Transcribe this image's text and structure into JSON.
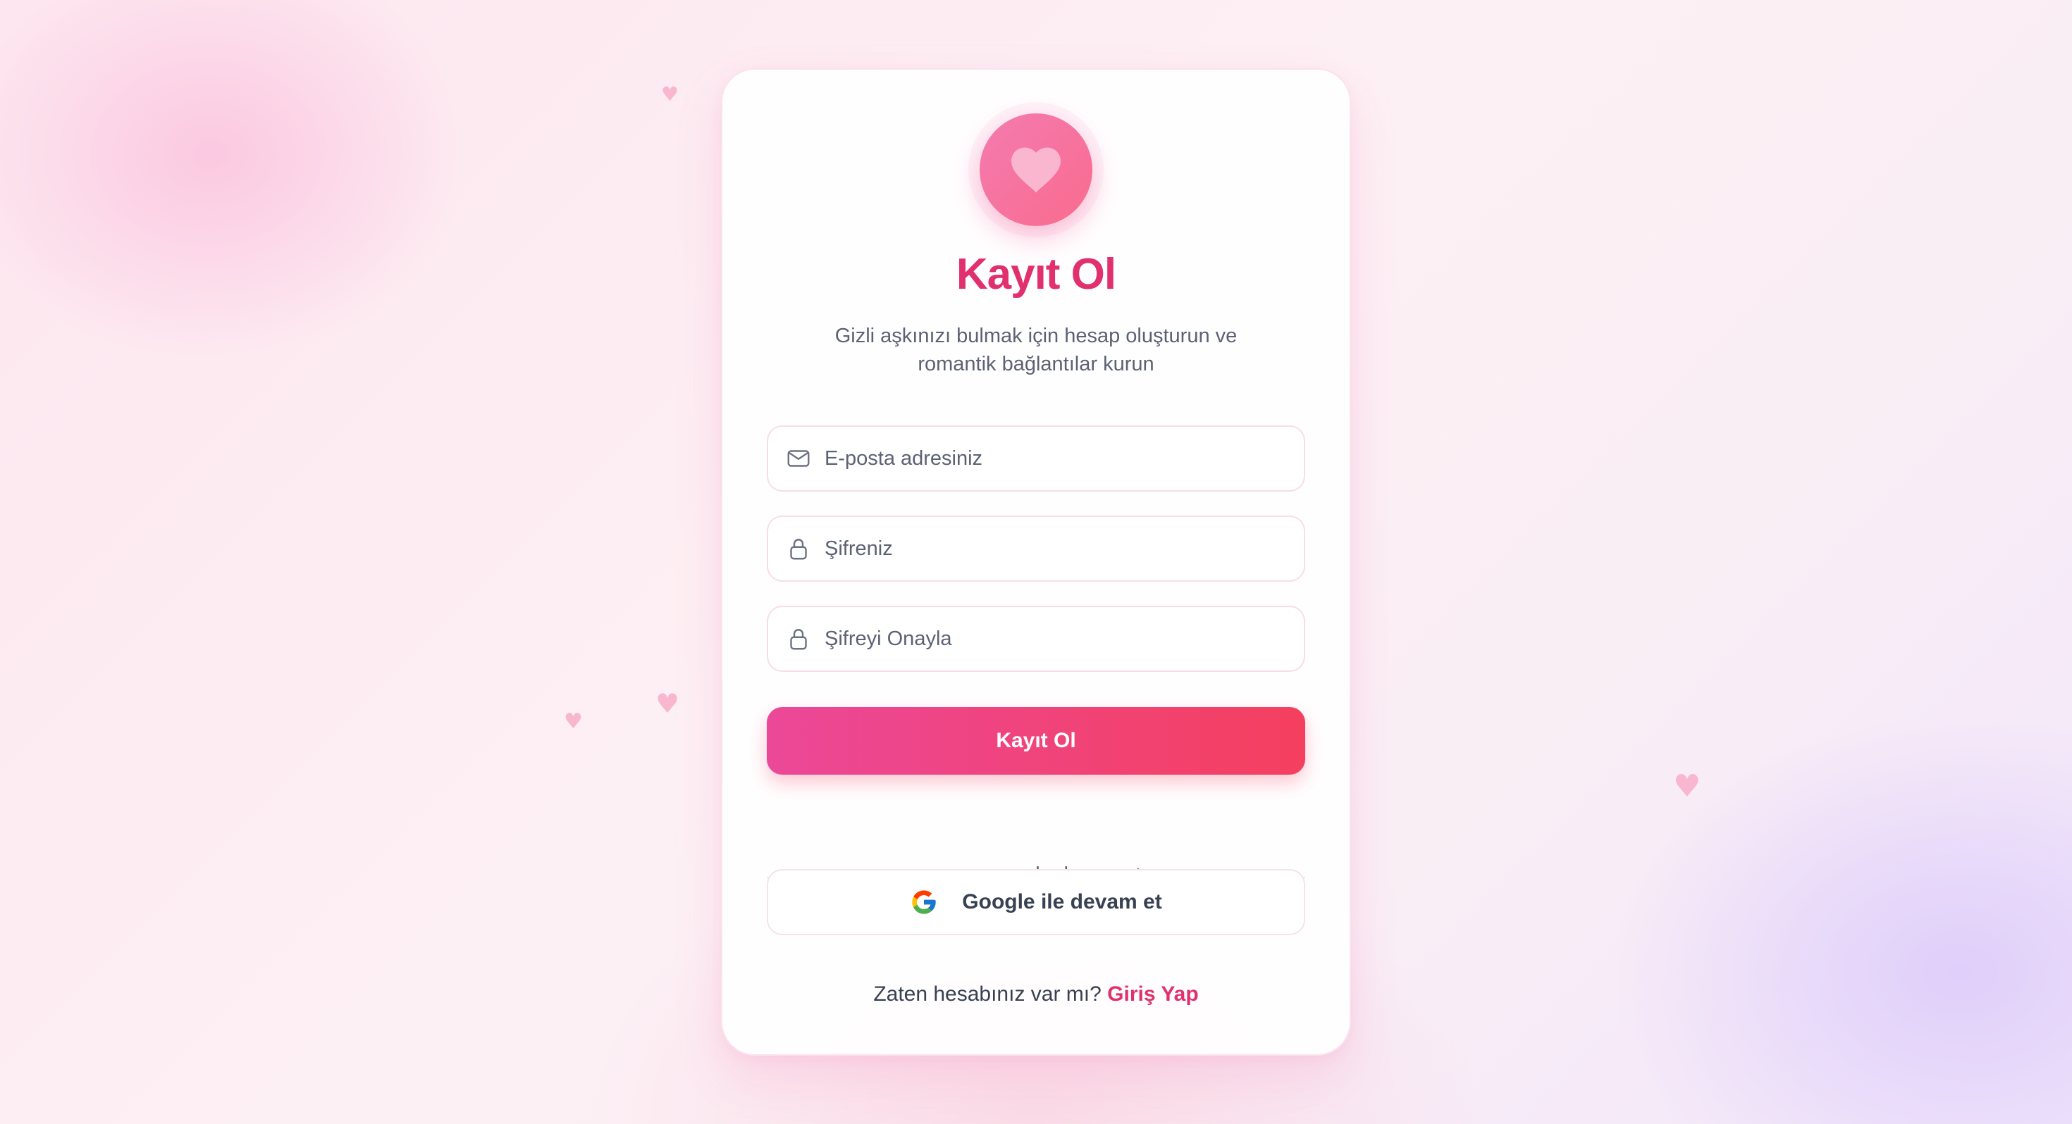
{
  "colors": {
    "accent": "#e0306e",
    "button_gradient_start": "#ec4899",
    "button_gradient_end": "#f43f5e",
    "logo_gradient_start": "#f47bb0",
    "logo_gradient_end": "#f96b8e",
    "muted_text": "#5b6273"
  },
  "card": {
    "logo_icon": "heart-icon",
    "title": "Kayıt Ol",
    "subtitle": "Gizli aşkınızı bulmak için hesap oluşturun ve romantik bağlantılar kurun"
  },
  "form": {
    "email": {
      "icon": "mail-icon",
      "placeholder": "E-posta adresiniz",
      "value": ""
    },
    "password": {
      "icon": "lock-icon",
      "placeholder": "Şifreniz",
      "value": ""
    },
    "confirm_password": {
      "icon": "lock-icon",
      "placeholder": "Şifreyi Onayla",
      "value": ""
    },
    "submit_label": "Kayıt Ol"
  },
  "divider_text": "veya şununla devam et",
  "google": {
    "icon": "google-icon",
    "label": "Google ile devam et"
  },
  "footer": {
    "prompt": "Zaten hesabınız var mı?",
    "link_label": "Giriş Yap"
  },
  "background_decorations": {
    "icon": "heart-icon"
  }
}
